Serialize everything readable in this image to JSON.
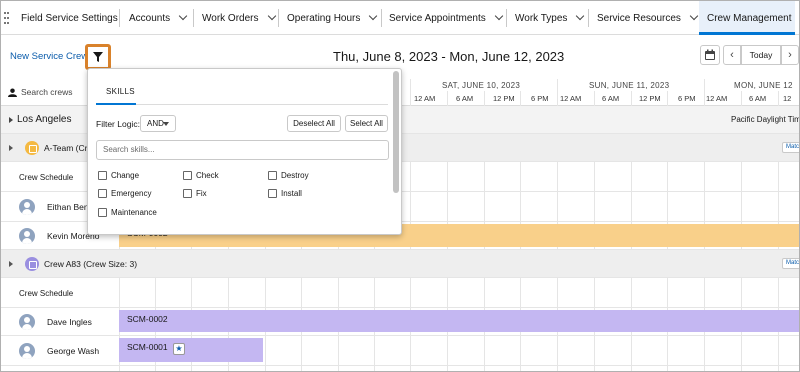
{
  "nav": {
    "tabs": [
      {
        "label": "Field Service Settings",
        "dropdown": false
      },
      {
        "label": "Accounts",
        "dropdown": true
      },
      {
        "label": "Work Orders",
        "dropdown": true
      },
      {
        "label": "Operating Hours",
        "dropdown": true
      },
      {
        "label": "Service Appointments",
        "dropdown": true
      },
      {
        "label": "Work Types",
        "dropdown": true
      },
      {
        "label": "Service Resources",
        "dropdown": true
      },
      {
        "label": "Crew Management",
        "dropdown": false,
        "active": true
      }
    ]
  },
  "toolbar": {
    "new_crew": "New Service Crew",
    "date_range": "Thu, June 8, 2023 - Mon, June 12, 2023",
    "today": "Today",
    "prev": "‹",
    "next": "›"
  },
  "search_crews": "Search crews",
  "timeline": {
    "days": [
      "SAT, JUNE 10, 2023",
      "SUN, JUNE 11, 2023",
      "MON, JUNE 12"
    ],
    "hours": [
      "12 AM",
      "12 AM",
      "6 AM",
      "12 PM",
      "6 PM",
      "12 AM",
      "6 AM",
      "12 PM",
      "6 PM",
      "12 AM",
      "6 AM",
      "12 PM"
    ]
  },
  "region": {
    "name": "Los Angeles",
    "timezone": "Pacific Daylight Tim"
  },
  "crews": [
    {
      "name": "A-Team (Cre",
      "color": "#f4b942",
      "schedule_label": "Crew Schedule",
      "members": [
        "Eithan Ben",
        "Kevin Moreno"
      ],
      "bar_label": "SCM-0002",
      "bar_color": "#f9d08a"
    },
    {
      "name": "Crew A83 (Crew Size: 3)",
      "color": "#9a8fe0",
      "schedule_label": "Crew Schedule",
      "members": [
        "Dave Ingles",
        "George Wash"
      ],
      "bars": [
        "SCM-0002",
        "SCM-0001"
      ],
      "bar_color": "#c4b7f2"
    }
  ],
  "match_btn": "Match",
  "filter_popup": {
    "tab": "SKILLS",
    "filter_logic_label": "Filter Logic:",
    "filter_logic_value": "AND",
    "deselect_all": "Deselect All",
    "select_all": "Select All",
    "search_placeholder": "Search skills...",
    "skills": [
      "Change",
      "Check",
      "Destroy",
      "Emergency",
      "Fix",
      "Install",
      "Maintenance"
    ]
  },
  "colors": {
    "accent": "#0176d3",
    "filter_highlight": "#d9822b"
  }
}
